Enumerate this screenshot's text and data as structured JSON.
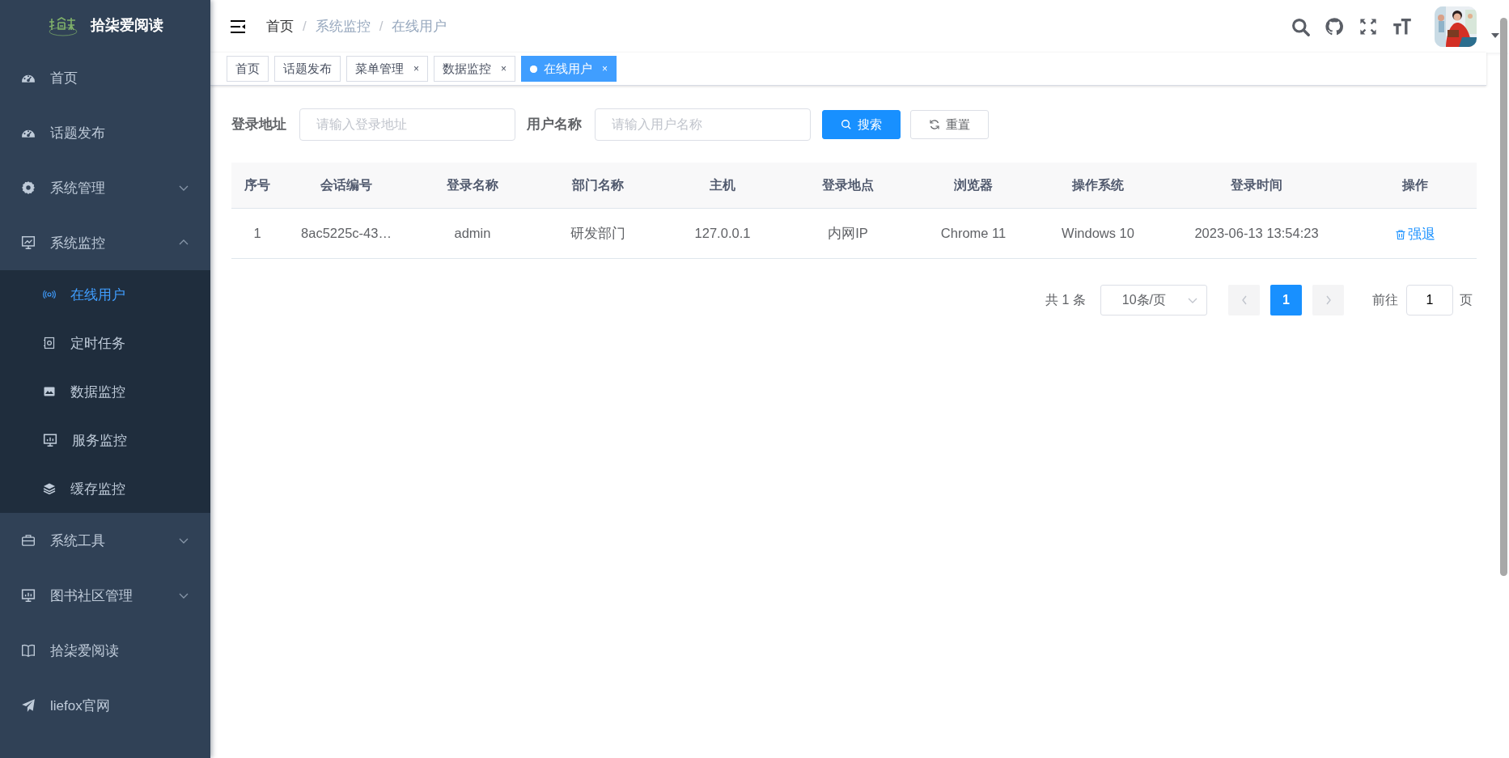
{
  "sidebar": {
    "logo_text": "拾柒爱阅读",
    "items": [
      {
        "kind": "link",
        "label": "首页",
        "selected": false
      },
      {
        "kind": "link",
        "label": "话题发布",
        "selected": false
      },
      {
        "kind": "submenu",
        "label": "系统管理",
        "expanded": false
      },
      {
        "kind": "submenu",
        "label": "系统监控",
        "expanded": true,
        "children": [
          {
            "label": "在线用户",
            "selected": true
          },
          {
            "label": "定时任务",
            "selected": false
          },
          {
            "label": "数据监控",
            "selected": false
          },
          {
            "label": "服务监控",
            "selected": false
          },
          {
            "label": "缓存监控",
            "selected": false
          }
        ]
      },
      {
        "kind": "submenu",
        "label": "系统工具",
        "expanded": false
      },
      {
        "kind": "submenu",
        "label": "图书社区管理",
        "expanded": false
      },
      {
        "kind": "link",
        "label": "拾柒爱阅读",
        "selected": false
      },
      {
        "kind": "link",
        "label": "liefox官网",
        "selected": false
      }
    ]
  },
  "navbar": {
    "breadcrumb": [
      {
        "label": "首页",
        "current": false
      },
      {
        "label": "系统监控",
        "current": true
      },
      {
        "label": "在线用户",
        "current": true
      }
    ],
    "separator": "/"
  },
  "tags": [
    {
      "label": "首页",
      "selected": false
    },
    {
      "label": "话题发布",
      "selected": false
    },
    {
      "label": "菜单管理",
      "selected": false,
      "close": "×"
    },
    {
      "label": "数据监控",
      "selected": false,
      "close": "×"
    },
    {
      "label": "在线用户",
      "selected": true,
      "close": "×"
    }
  ],
  "search_form": {
    "fields": [
      {
        "label": "登录地址",
        "placeholder": "请输入登录地址"
      },
      {
        "label": "用户名称",
        "placeholder": "请输入用户名称"
      }
    ],
    "buttons": [
      {
        "kind": "primary",
        "label": "搜索"
      },
      {
        "kind": "default",
        "label": "重置"
      }
    ]
  },
  "table": {
    "columns": [
      "序号",
      "会话编号",
      "登录名称",
      "部门名称",
      "主机",
      "登录地点",
      "浏览器",
      "操作系统",
      "登录时间",
      "操作"
    ],
    "rows": [
      {
        "cells": [
          "1",
          "8ac5225c-43…",
          "admin",
          "研发部门",
          "127.0.0.1",
          "内网IP",
          "Chrome 11",
          "Windows 10",
          "2023-06-13 13:54:23"
        ],
        "action": "强退"
      }
    ]
  },
  "pagination": {
    "total": "共 1 条",
    "page_size": "10条/页",
    "prev_disabled": true,
    "next_disabled": true,
    "pages": [
      {
        "label": "1",
        "selected": true
      }
    ],
    "jump_prefix": "前往",
    "jump_value": "1",
    "jump_suffix": "页"
  }
}
